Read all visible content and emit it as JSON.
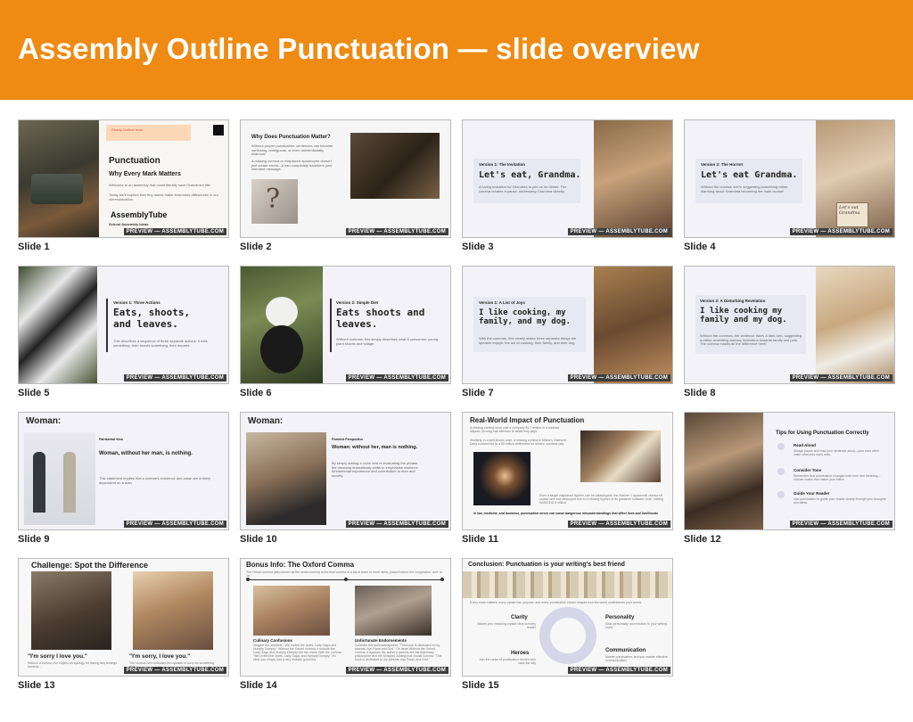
{
  "page": {
    "title": "Assembly Outline Punctuation — slide overview",
    "accent": "#ef8a12"
  },
  "preview_label": "PREVIEW — ASSEMBLYTUBE.COM",
  "slides": [
    {
      "caption": "Slide 1",
      "tag": "Ready-Outline texts",
      "title": "Punctuation",
      "subtitle": "Why Every Mark Matters",
      "body1": "Welcome to an assembly that could literally save Grandma's life!",
      "body2": "Today we'll explore how tiny marks make enormous differences in our communication.",
      "logo": "AssemblyTube",
      "logo_sub": "School Assembly Ideas"
    },
    {
      "caption": "Slide 2",
      "title": "Why Does Punctuation Matter?",
      "body1": "Without proper punctuation, sentences can become confusing, ambiguous, or even unintentionally hilarious!",
      "body2": "A missing comma or misplaced apostrophe doesn't just create errors—it can completely transform your intended message."
    },
    {
      "caption": "Slide 3",
      "kicker": "Version 1: The Invitation",
      "title": "Let's eat, Grandma.",
      "body1": "A loving invitation for Grandma to join us for dinner. The comma creates a pause, addressing Grandma directly."
    },
    {
      "caption": "Slide 4",
      "kicker": "Version 2: The Horror!",
      "title": "Let's eat Grandma.",
      "body1": "Without the comma, we're suggesting something rather alarming about Grandma becoming the main course!",
      "sign": "Let's eat Grandma"
    },
    {
      "caption": "Slide 5",
      "kicker": "Version 1: Three Actions",
      "title": "Eats, shoots, and leaves.",
      "body1": "This describes a sequence of three separate actions: it eats something, then shoots something, then departs."
    },
    {
      "caption": "Slide 6",
      "kicker": "Version 2: Simple Diet",
      "title": "Eats shoots and leaves.",
      "body1": "Without commas, this simply describes what it consumes: young plant shoots and foliage."
    },
    {
      "caption": "Slide 7",
      "kicker": "Version 1: A List of Joys",
      "title": "I like cooking, my family, and my dog.",
      "body1": "With the commas, this clearly states three separate things the speaker enjoys: the act of cooking, their family, and their dog."
    },
    {
      "caption": "Slide 8",
      "kicker": "Version 2: A Disturbing Revelation",
      "title": "I like cooking my family and my dog.",
      "body1": "Without the commas, the sentence takes a dark turn, suggesting a rather unsettling culinary inclination towards family and pets. The comma makes all the difference here!"
    },
    {
      "caption": "Slide 9",
      "title": "Woman:",
      "kicker": "Patriarchal View",
      "quote": "Woman, without her man, is nothing.",
      "body1": "This statement implies that a woman's existence and value are entirely dependent on a man."
    },
    {
      "caption": "Slide 10",
      "title": "Woman:",
      "kicker": "Feminist Perspective",
      "quote": "Woman: without her, man is nothing.",
      "body1": "By simply adding a colon and re-evaluating the phrase, the meaning dramatically shifts to emphasise women's fundamental importance and contribution to men and society."
    },
    {
      "caption": "Slide 11",
      "title": "Real-World Impact of Punctuation",
      "body1": "A missing comma once cost a company $1.7 million in a contract dispute, proving that attention to detail truly pays.",
      "body2": "Similarly, in a well-known case, a missing comma in Maine's Oakhurst Dairy contract led to a $5 million settlement for drivers' overtime pay.",
      "body3": "Even a single misplaced hyphen can be catastrophic: the Mariner 1 spacecraft veered off course and was destroyed due to a missing hyphen in its guidance software code, costing NASA $18.5 million.",
      "footer": "In law, medicine, and business, punctuation errors can cause dangerous misunderstandings that affect lives and livelihoods"
    },
    {
      "caption": "Slide 12",
      "title": "Tips for Using Punctuation Correctly",
      "tips": [
        {
          "title": "Read Aloud",
          "body": "Always pause and read your sentence aloud—your ears often catch what your eyes miss."
        },
        {
          "title": "Consider Tone",
          "body": "Remember that punctuation changes both tone and meaning—choose marks that match your intent."
        },
        {
          "title": "Guide Your Reader",
          "body": "Use punctuation to guide your reader clearly through your thoughts and ideas."
        }
      ]
    },
    {
      "caption": "Slide 13",
      "title": "Challenge: Spot the Difference",
      "quote1": "\"I'm sorry I love you.\"",
      "quote2": "\"I'm sorry, I love you.\"",
      "body1": "Without a comma, the implies an apology for having any feelings towards...",
      "body2": "The comma here indicates the speaker is sorry for something else..."
    },
    {
      "caption": "Slide 14",
      "title": "Bonus Info: The Oxford Comma",
      "intro": "The Oxford comma (also known as the serial comma) is the final comma in a list of three or more items, placed before the conjunction \"and\" or \"or.\"",
      "col1_title": "Culinary Confusions",
      "col1_body": "Imagine the headline: \"We invited the chefs, Lady Gaga and Humpty Dumpty.\" Without the Oxford comma, it sounds like Lady Gaga and Humpty Dumpty are the chefs! With the comma: \"We invited the chefs, Lady Gaga, and Humpty Dumpty.\" It's clear you simply had a very eclectic guest list.",
      "col2_title": "Unfortunate Endorsements",
      "col2_body": "Consider this acknowledgment: \"This book is dedicated to my parents, Ayn Rand and God.\" Oh dear! Without the Oxford comma, it appears the author's parents are the legendary philosopher and the Almighty. Adding that crucial comma: \"This book is dedicated to my parents, Ayn Rand, and God.\""
    },
    {
      "caption": "Slide 15",
      "title": "Conclusion: Punctuation is your writing's best friend",
      "intro": "Every mark matters, every pause has purpose, and every punctuation choice shapes how the world understands your words.",
      "items": [
        {
          "title": "Clarity",
          "body": "Makes your meaning crystal clear to every reader"
        },
        {
          "title": "Personality",
          "body": "Adds personality and emotion to your writing voice"
        },
        {
          "title": "Heroes",
          "body": "Join the ranks of punctuation heroes who save the day"
        },
        {
          "title": "Communication",
          "body": "Master punctuation, and you master effective communication"
        }
      ]
    }
  ]
}
